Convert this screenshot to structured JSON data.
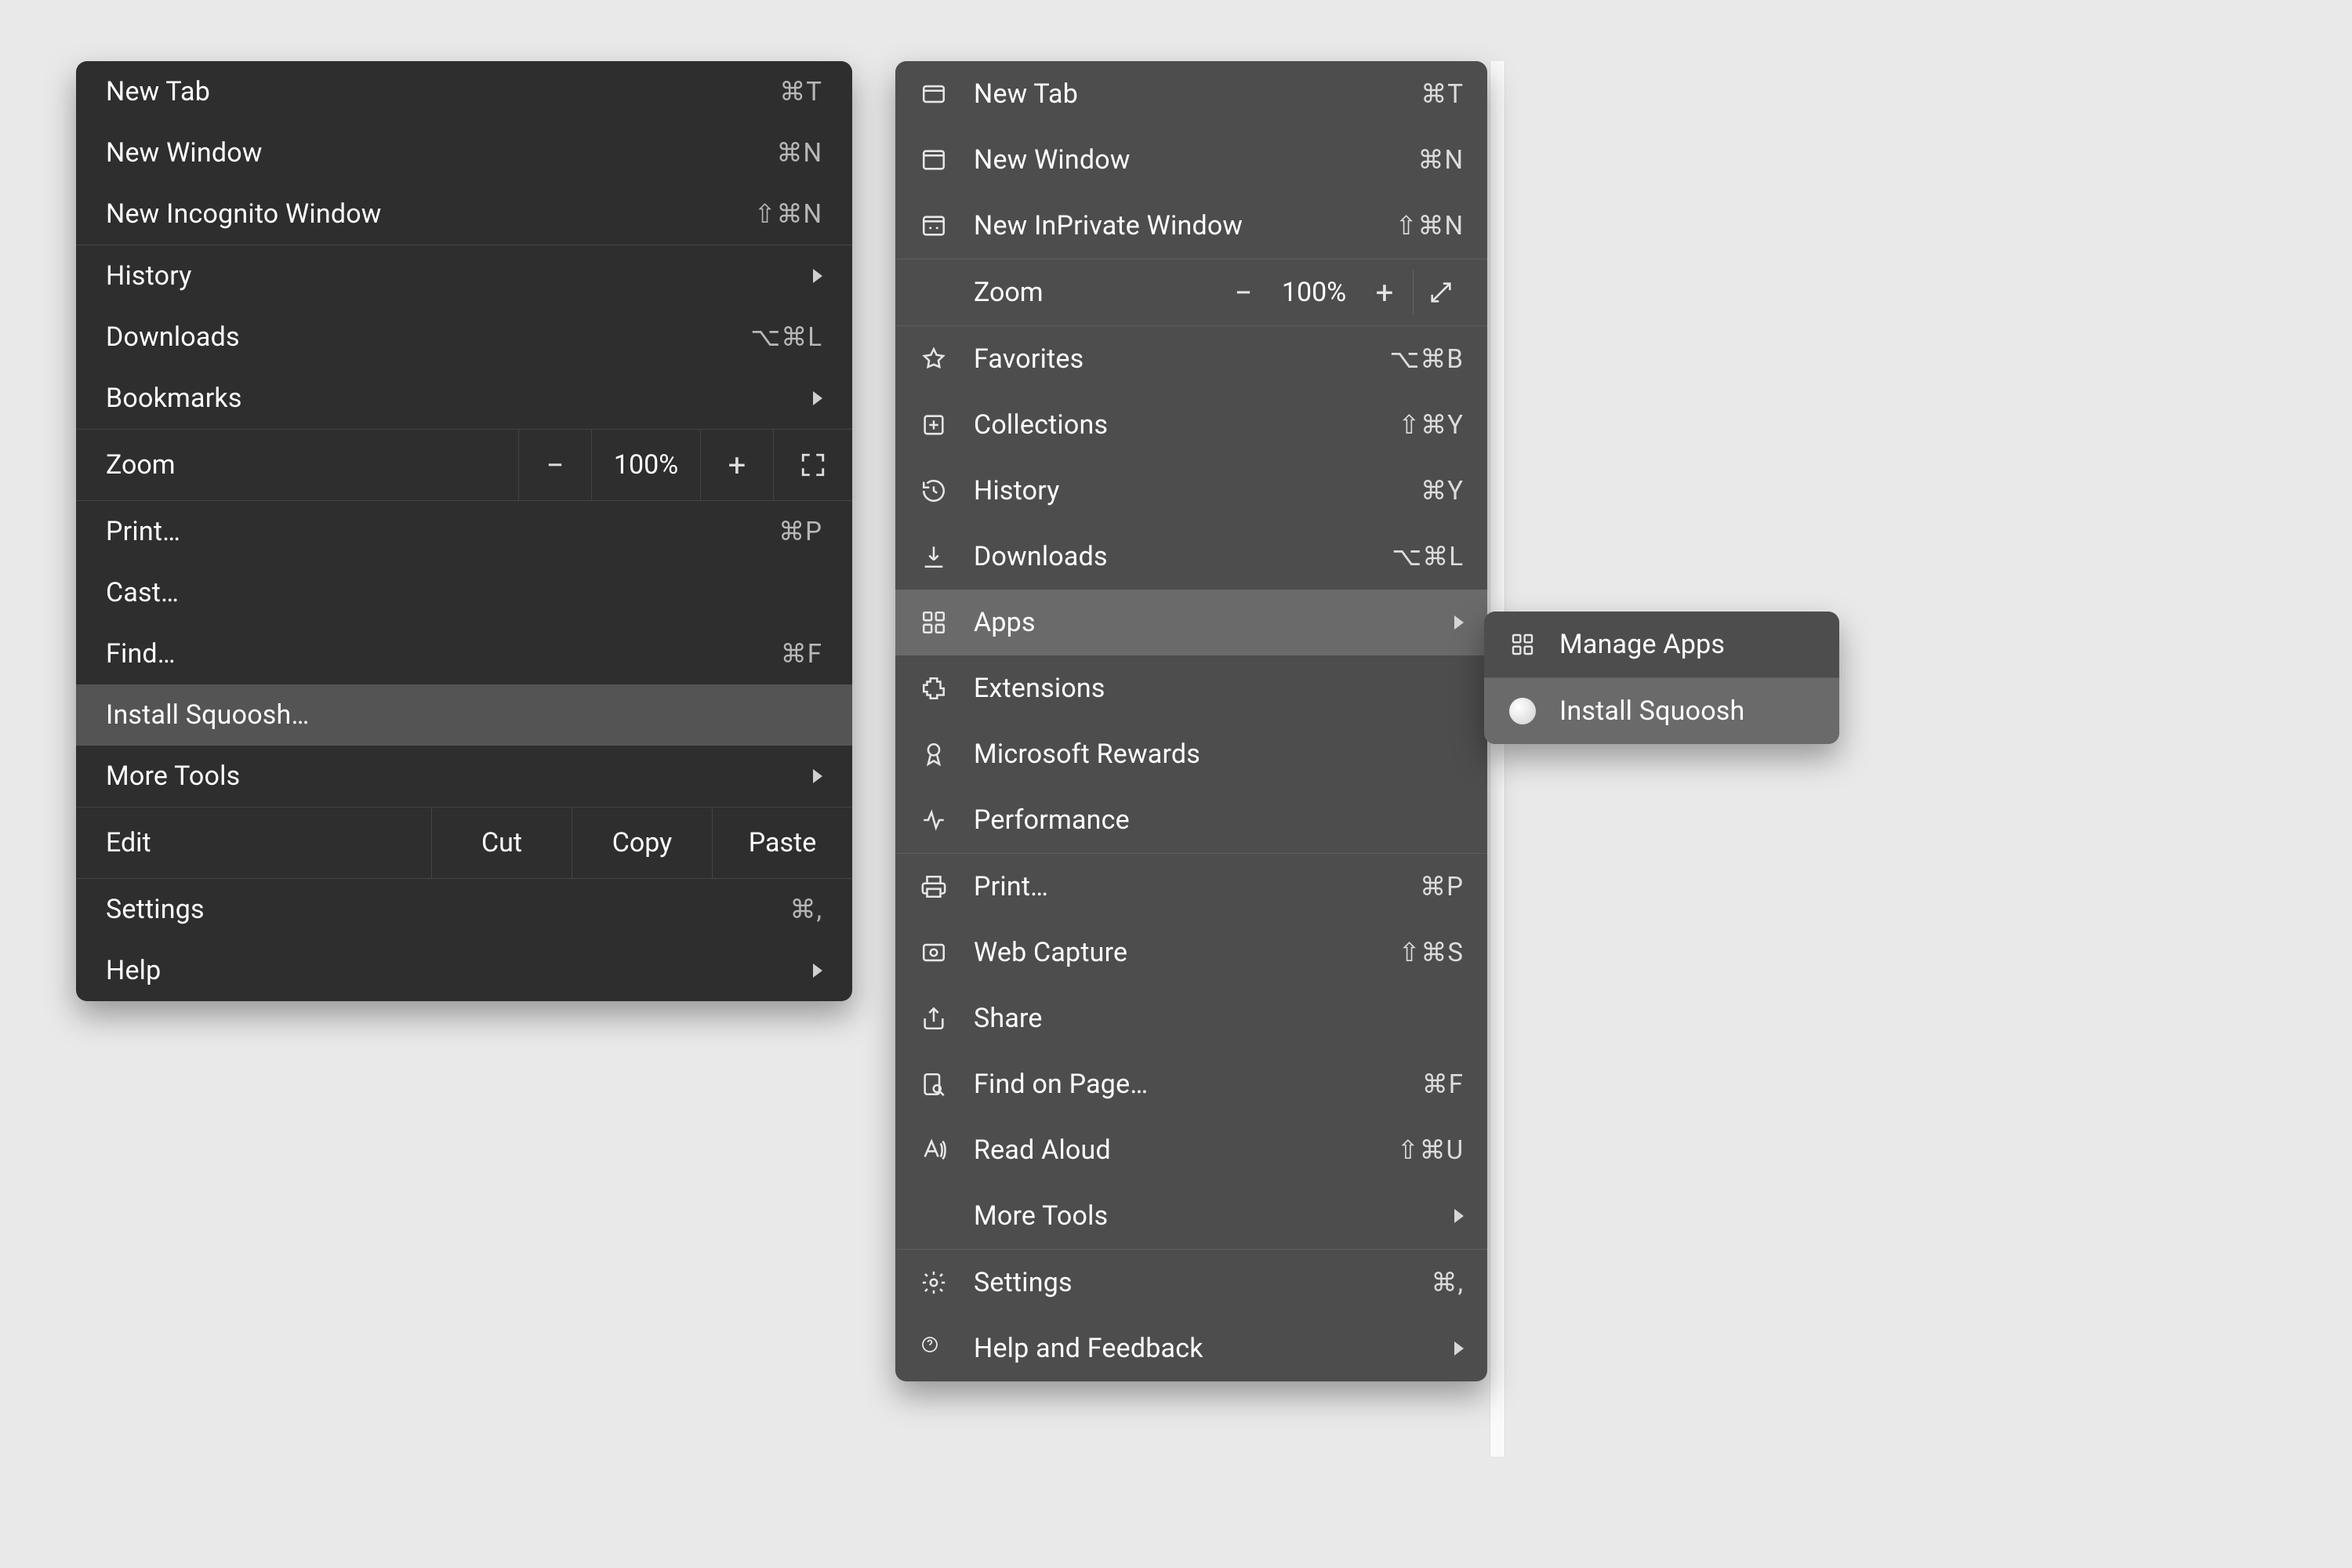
{
  "chrome": {
    "group1": [
      {
        "label": "New Tab",
        "short": "⌘T"
      },
      {
        "label": "New Window",
        "short": "⌘N"
      },
      {
        "label": "New Incognito Window",
        "short": "⇧⌘N"
      }
    ],
    "history": {
      "label": "History"
    },
    "downloads": {
      "label": "Downloads",
      "short": "⌥⌘L"
    },
    "bookmarks": {
      "label": "Bookmarks"
    },
    "zoom": {
      "label": "Zoom",
      "minus": "−",
      "value": "100%",
      "plus": "+"
    },
    "print": {
      "label": "Print…",
      "short": "⌘P"
    },
    "cast": {
      "label": "Cast…"
    },
    "find": {
      "label": "Find…",
      "short": "⌘F"
    },
    "install": {
      "label": "Install Squoosh…"
    },
    "more_tools": {
      "label": "More Tools"
    },
    "edit": {
      "label": "Edit",
      "cut": "Cut",
      "copy": "Copy",
      "paste": "Paste"
    },
    "settings": {
      "label": "Settings",
      "short": "⌘,"
    },
    "help": {
      "label": "Help"
    }
  },
  "edge": {
    "new_tab": {
      "label": "New Tab",
      "short": "⌘T"
    },
    "new_window": {
      "label": "New Window",
      "short": "⌘N"
    },
    "inprivate": {
      "label": "New InPrivate Window",
      "short": "⇧⌘N"
    },
    "zoom": {
      "label": "Zoom",
      "minus": "−",
      "value": "100%",
      "plus": "+"
    },
    "favorites": {
      "label": "Favorites",
      "short": "⌥⌘B"
    },
    "collections": {
      "label": "Collections",
      "short": "⇧⌘Y"
    },
    "history": {
      "label": "History",
      "short": "⌘Y"
    },
    "downloads": {
      "label": "Downloads",
      "short": "⌥⌘L"
    },
    "apps": {
      "label": "Apps"
    },
    "extensions": {
      "label": "Extensions"
    },
    "rewards": {
      "label": "Microsoft Rewards"
    },
    "performance": {
      "label": "Performance"
    },
    "print": {
      "label": "Print…",
      "short": "⌘P"
    },
    "web_capture": {
      "label": "Web Capture",
      "short": "⇧⌘S"
    },
    "share": {
      "label": "Share"
    },
    "find": {
      "label": "Find on Page…",
      "short": "⌘F"
    },
    "read_aloud": {
      "label": "Read Aloud",
      "short": "⇧⌘U"
    },
    "more_tools": {
      "label": "More Tools"
    },
    "settings": {
      "label": "Settings",
      "short": "⌘,"
    },
    "help": {
      "label": "Help and Feedback"
    }
  },
  "submenu": {
    "manage": {
      "label": "Manage Apps"
    },
    "install": {
      "label": "Install Squoosh"
    }
  }
}
